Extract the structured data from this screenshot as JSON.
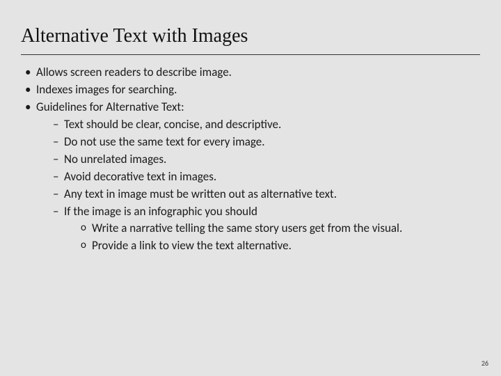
{
  "title": "Alternative Text with Images",
  "bullets": {
    "b0": "Allows screen readers to describe image.",
    "b1": "Indexes images for searching.",
    "b2": "Guidelines for Alternative Text:",
    "b2_sub": {
      "s0": "Text should be clear, concise, and descriptive.",
      "s1": "Do not use the same text for every image.",
      "s2": "No unrelated images.",
      "s3": "Avoid decorative text in images.",
      "s4": "Any text in image must be written out as alternative text.",
      "s5": "If the image is an infographic you should",
      "s5_sub": {
        "t0": "Write a narrative telling the same story users get from the visual.",
        "t1": "Provide a link to view the text alternative."
      }
    }
  },
  "page_number": "26"
}
